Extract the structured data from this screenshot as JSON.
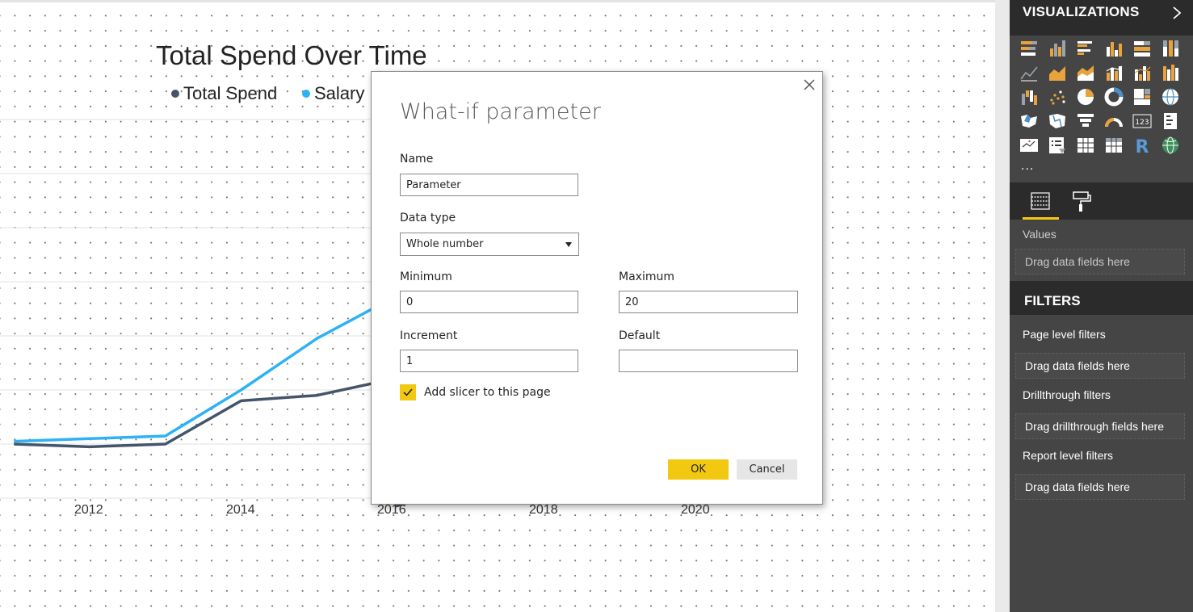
{
  "chart": {
    "title": "Total Spend Over Time",
    "legend": [
      {
        "label": "Total Spend",
        "color": "#44546a"
      },
      {
        "label": "Salary",
        "color": "#2eb1f5"
      }
    ],
    "x_ticks": [
      "2012",
      "2014",
      "2016",
      "2018",
      "2020"
    ]
  },
  "chart_data": {
    "type": "line",
    "title": "Total Spend Over Time",
    "xlabel": "",
    "ylabel": "",
    "x": [
      2011,
      2012,
      2013,
      2014,
      2015,
      2016
    ],
    "series": [
      {
        "name": "Total Spend",
        "color": "#44546a",
        "values": [
          100,
          99,
          100,
          116,
          118,
          124
        ]
      },
      {
        "name": "Salary",
        "color": "#2eb1f5",
        "values": [
          101,
          102,
          103,
          120,
          139,
          154
        ]
      }
    ],
    "xlim": [
      2010.8,
      2021.4
    ],
    "ylim": [
      80,
      220
    ],
    "grid": true,
    "legend_position": "top-left"
  },
  "dialog": {
    "title": "What-if parameter",
    "name_label": "Name",
    "name_value": "Parameter",
    "datatype_label": "Data type",
    "datatype_value": "Whole number",
    "minimum_label": "Minimum",
    "minimum_value": "0",
    "maximum_label": "Maximum",
    "maximum_value": "20",
    "increment_label": "Increment",
    "increment_value": "1",
    "default_label": "Default",
    "default_value": "",
    "slicer_label": "Add slicer to this page",
    "slicer_checked": true,
    "ok_label": "OK",
    "cancel_label": "Cancel"
  },
  "pane": {
    "visualizations_title": "VISUALIZATIONS",
    "more": "...",
    "values_label": "Values",
    "values_drop": "Drag data fields here",
    "filters_title": "FILTERS",
    "page_filters_label": "Page level filters",
    "page_filters_drop": "Drag data fields here",
    "drillthrough_label": "Drillthrough filters",
    "drillthrough_drop": "Drag drillthrough fields here",
    "report_filters_label": "Report level filters",
    "report_filters_drop": "Drag data fields here",
    "r_visual_label": "R",
    "card_label": "123",
    "accent_color": "#f2c811",
    "viz_icons": [
      "stacked-bar-chart-icon",
      "stacked-column-chart-icon",
      "clustered-bar-chart-icon",
      "clustered-column-chart-icon",
      "100-percent-stacked-bar-icon",
      "100-percent-stacked-column-icon",
      "line-chart-icon",
      "area-chart-icon",
      "stacked-area-chart-icon",
      "line-and-stacked-column-icon",
      "line-and-clustered-column-icon",
      "ribbon-chart-icon",
      "waterfall-chart-icon",
      "scatter-chart-icon",
      "pie-chart-icon",
      "donut-chart-icon",
      "treemap-icon",
      "map-icon",
      "filled-map-icon",
      "shape-map-icon",
      "funnel-icon",
      "gauge-icon",
      "card-icon",
      "multi-row-card-icon",
      "kpi-icon",
      "slicer-icon",
      "table-icon",
      "matrix-icon",
      "r-visual-icon",
      "arcgis-map-icon"
    ]
  }
}
